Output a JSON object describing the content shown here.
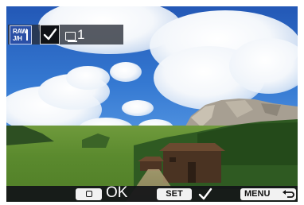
{
  "image_info": {
    "quality_icon": "raw-jpeg-quality-icon",
    "quality_line1": "RAW",
    "quality_line2": "J/H",
    "print_selected_icon": "checkmark-icon",
    "copies_icon": "print-copies-icon",
    "copies": "1"
  },
  "bottom_bar": {
    "playback_key_icon": "magnify-playback-icon",
    "ok_label": "OK",
    "set_label": "SET",
    "set_action_icon": "checkmark-icon",
    "menu_label": "MENU",
    "menu_action_icon": "return-arrow-icon"
  },
  "colors": {
    "sky": "#3579d2",
    "grass": "#5b8a2e",
    "quality_badge": "#2a4fa6",
    "bar_background": "#121418",
    "key_background": "#f2f2f2"
  }
}
